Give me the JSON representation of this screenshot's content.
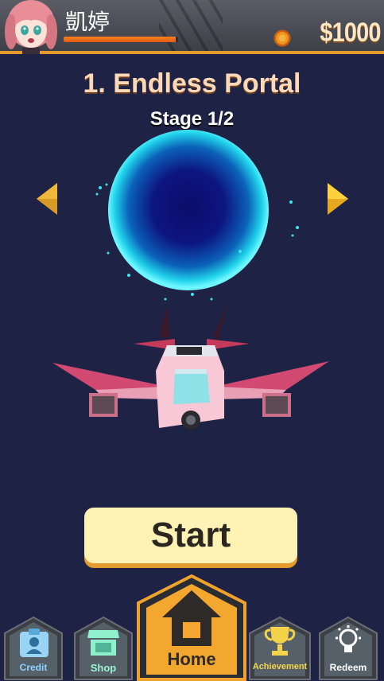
{
  "player": {
    "name": "凱婷",
    "xp_fraction": 0.98,
    "money": "$1000"
  },
  "stage": {
    "title": "1. Endless Portal",
    "subtitle": "Stage 1/2"
  },
  "start_label": "Start",
  "nav": {
    "credit": "Credit",
    "shop": "Shop",
    "home": "Home",
    "achievement": "Achievement",
    "redeem": "Redeem"
  },
  "colors": {
    "background": "#1e2245",
    "accent": "#e39a2a",
    "start_button": "#fff2b5",
    "portal": "#19d6ea",
    "ship": "#f4b7c8"
  },
  "icons": [
    "coin-icon",
    "avatar",
    "arrow-left-icon",
    "arrow-right-icon",
    "id-card-icon",
    "store-icon",
    "house-icon",
    "trophy-icon",
    "lightbulb-icon"
  ]
}
